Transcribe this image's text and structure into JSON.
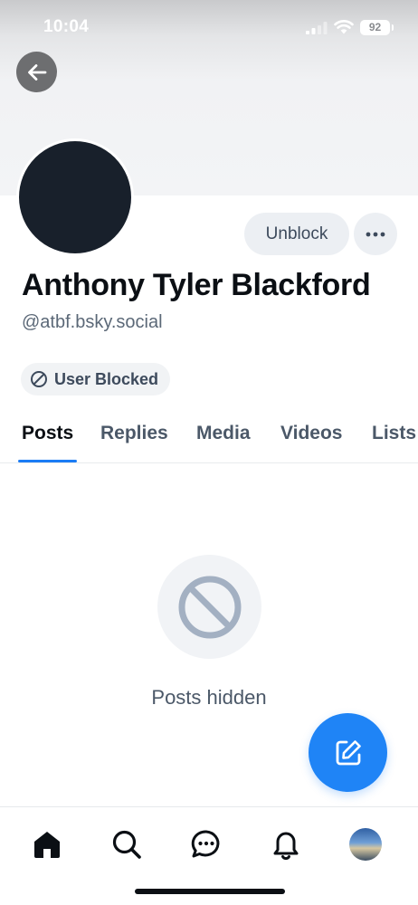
{
  "status_bar": {
    "time": "10:04",
    "battery": "92"
  },
  "profile": {
    "display_name": "Anthony Tyler Blackford",
    "handle": "@atbf.bsky.social",
    "unblock_label": "Unblock",
    "blocked_badge": "User Blocked"
  },
  "tabs": [
    {
      "label": "Posts",
      "active": true
    },
    {
      "label": "Replies"
    },
    {
      "label": "Media"
    },
    {
      "label": "Videos"
    },
    {
      "label": "Lists"
    }
  ],
  "empty_state": {
    "message": "Posts hidden",
    "icon": "blocked-circle-icon"
  },
  "bottom_nav": [
    {
      "name": "home",
      "icon": "home-icon",
      "active": true
    },
    {
      "name": "search",
      "icon": "search-icon"
    },
    {
      "name": "chat",
      "icon": "chat-bubble-icon"
    },
    {
      "name": "notifications",
      "icon": "bell-icon"
    },
    {
      "name": "profile",
      "icon": "avatar"
    }
  ],
  "colors": {
    "accent": "#1b7cf5",
    "fab": "#1f84f6",
    "avatar": "#18202b",
    "muted_text": "#5b6877"
  }
}
